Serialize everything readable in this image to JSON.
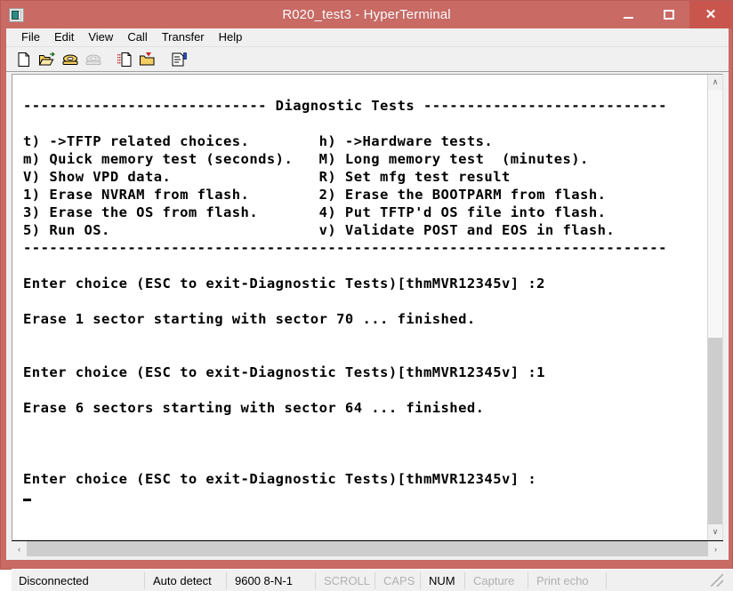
{
  "window": {
    "title": "R020_test3 - HyperTerminal",
    "icon": "hyperterminal-icon",
    "accent_color": "#c96a64",
    "close_color": "#c9564e",
    "caption": {
      "minimize": "minimize-button",
      "maximize": "maximize-button",
      "close_glyph": "✕"
    }
  },
  "menubar": {
    "items": [
      {
        "label": "File"
      },
      {
        "label": "Edit"
      },
      {
        "label": "View"
      },
      {
        "label": "Call"
      },
      {
        "label": "Transfer"
      },
      {
        "label": "Help"
      }
    ]
  },
  "toolbar": {
    "buttons": [
      {
        "name": "new-connection-icon",
        "tip": "New"
      },
      {
        "name": "open-folder-icon",
        "tip": "Open"
      },
      {
        "name": "call-phone-icon",
        "tip": "Call"
      },
      {
        "name": "disconnect-phone-icon",
        "tip": "Disconnect",
        "disabled": true
      },
      {
        "name": "send-file-icon",
        "tip": "Send"
      },
      {
        "name": "receive-file-icon",
        "tip": "Receive"
      },
      {
        "name": "properties-icon",
        "tip": "Properties"
      }
    ]
  },
  "terminal": {
    "lines": [
      "",
      "---------------------------- Diagnostic Tests ----------------------------",
      "",
      "t) ->TFTP related choices.        h) ->Hardware tests.",
      "m) Quick memory test (seconds).   M) Long memory test  (minutes).",
      "V) Show VPD data.                 R) Set mfg test result",
      "1) Erase NVRAM from flash.        2) Erase the BOOTPARM from flash.",
      "3) Erase the OS from flash.       4) Put TFTP'd OS file into flash.",
      "5) Run OS.                        v) Validate POST and EOS in flash.",
      "--------------------------------------------------------------------------",
      "",
      "Enter choice (ESC to exit-Diagnostic Tests)[thmMVR12345v] :2",
      "",
      "Erase 1 sector starting with sector 70 ... finished.",
      "",
      "",
      "Enter choice (ESC to exit-Diagnostic Tests)[thmMVR12345v] :1",
      "",
      "Erase 6 sectors starting with sector 64 ... finished.",
      "",
      "",
      "",
      "Enter choice (ESC to exit-Diagnostic Tests)[thmMVR12345v] :"
    ],
    "cursor": "_"
  },
  "scrollbars": {
    "vertical": {
      "up": "∧",
      "down": "∨"
    },
    "horizontal": {
      "left": "‹",
      "right": "›"
    }
  },
  "statusbar": {
    "connection": "Disconnected",
    "detect": "Auto detect",
    "settings": "9600 8-N-1",
    "scroll": "SCROLL",
    "caps": "CAPS",
    "num": "NUM",
    "capture": "Capture",
    "print_echo": "Print echo"
  }
}
